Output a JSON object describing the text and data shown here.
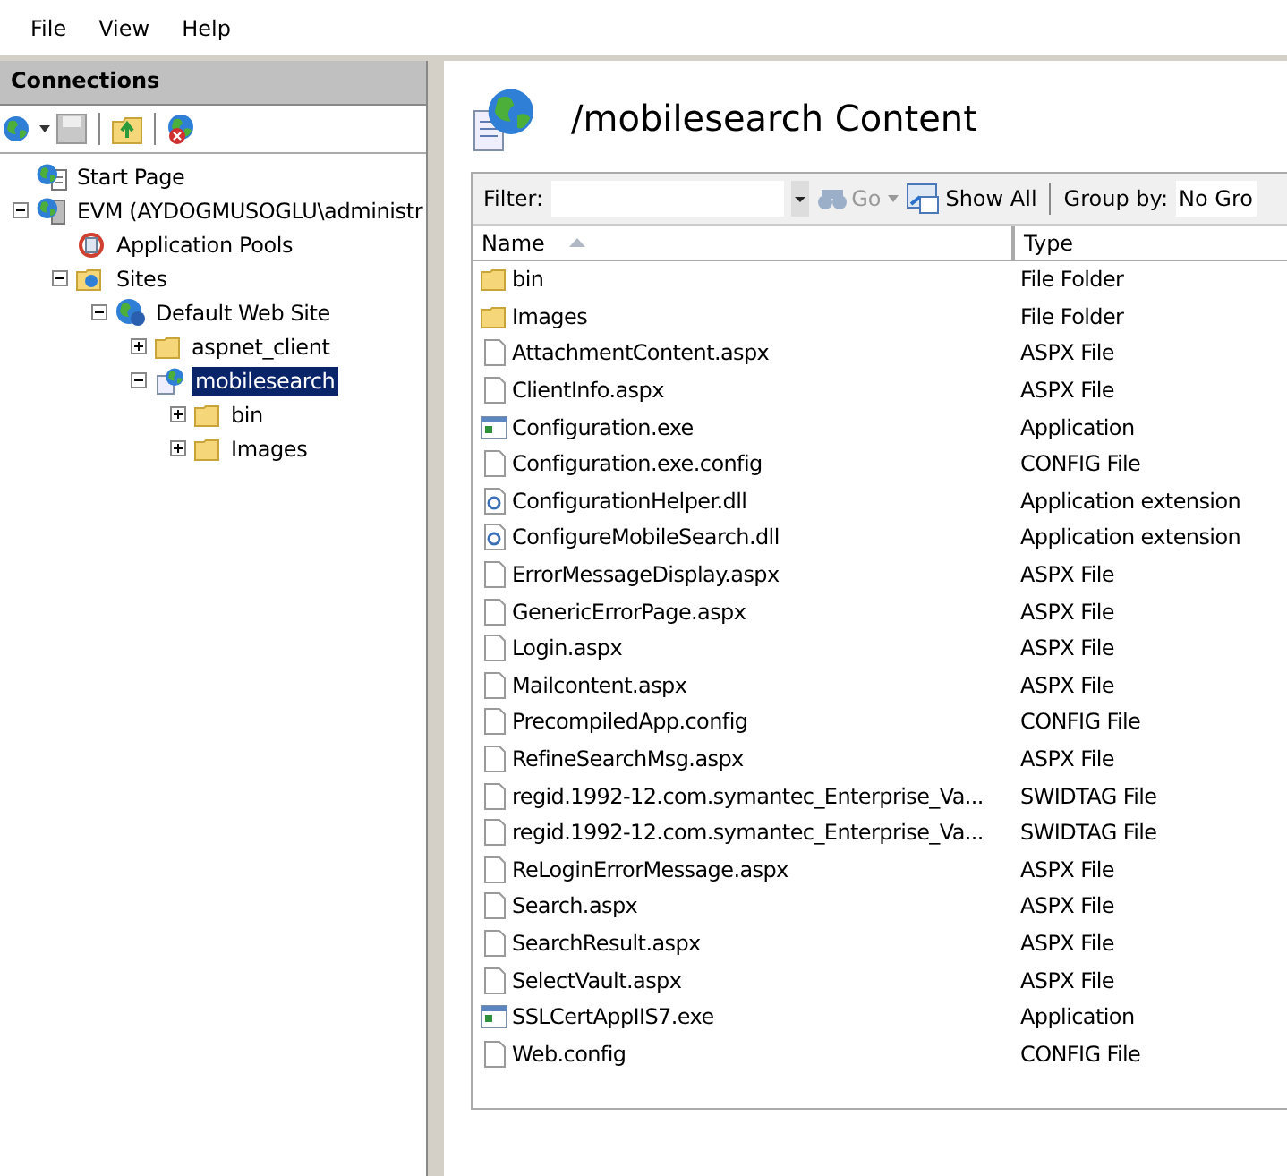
{
  "menu": [
    "File",
    "View",
    "Help"
  ],
  "connections": {
    "title": "Connections",
    "tree": [
      {
        "label": "Start Page",
        "kind": "start-page"
      },
      {
        "label": "EVM (AYDOGMUSOGLU\\administr",
        "kind": "server",
        "expanded": true,
        "children": [
          {
            "label": "Application Pools",
            "kind": "app-pools"
          },
          {
            "label": "Sites",
            "kind": "sites",
            "expanded": true,
            "children": [
              {
                "label": "Default Web Site",
                "kind": "website",
                "expanded": true,
                "children": [
                  {
                    "label": "aspnet_client",
                    "kind": "folder",
                    "expanded": false
                  },
                  {
                    "label": "mobilesearch",
                    "kind": "application",
                    "expanded": true,
                    "selected": true,
                    "children": [
                      {
                        "label": "bin",
                        "kind": "folder",
                        "expanded": false
                      },
                      {
                        "label": "Images",
                        "kind": "folder",
                        "expanded": false
                      }
                    ]
                  }
                ]
              }
            ]
          }
        ]
      }
    ]
  },
  "content": {
    "title": "/mobilesearch Content",
    "filter": {
      "label": "Filter:",
      "go": "Go",
      "show_all": "Show All",
      "group_by_label": "Group by:",
      "group_by_value": "No Gro"
    },
    "columns": [
      "Name",
      "Type"
    ],
    "rows": [
      {
        "name": "bin",
        "type": "File Folder",
        "kind": "folder"
      },
      {
        "name": "Images",
        "type": "File Folder",
        "kind": "folder"
      },
      {
        "name": "AttachmentContent.aspx",
        "type": "ASPX File",
        "kind": "file"
      },
      {
        "name": "ClientInfo.aspx",
        "type": "ASPX File",
        "kind": "file"
      },
      {
        "name": "Configuration.exe",
        "type": "Application",
        "kind": "exe"
      },
      {
        "name": "Configuration.exe.config",
        "type": "CONFIG File",
        "kind": "file"
      },
      {
        "name": "ConfigurationHelper.dll",
        "type": "Application extension",
        "kind": "dll"
      },
      {
        "name": "ConfigureMobileSearch.dll",
        "type": "Application extension",
        "kind": "dll"
      },
      {
        "name": "ErrorMessageDisplay.aspx",
        "type": "ASPX File",
        "kind": "file"
      },
      {
        "name": "GenericErrorPage.aspx",
        "type": "ASPX File",
        "kind": "file"
      },
      {
        "name": "Login.aspx",
        "type": "ASPX File",
        "kind": "file"
      },
      {
        "name": "Mailcontent.aspx",
        "type": "ASPX File",
        "kind": "file"
      },
      {
        "name": "PrecompiledApp.config",
        "type": "CONFIG File",
        "kind": "file"
      },
      {
        "name": "RefineSearchMsg.aspx",
        "type": "ASPX File",
        "kind": "file"
      },
      {
        "name": "regid.1992-12.com.symantec_Enterprise_Va...",
        "type": "SWIDTAG File",
        "kind": "file"
      },
      {
        "name": "regid.1992-12.com.symantec_Enterprise_Va...",
        "type": "SWIDTAG File",
        "kind": "file"
      },
      {
        "name": "ReLoginErrorMessage.aspx",
        "type": "ASPX File",
        "kind": "file"
      },
      {
        "name": "Search.aspx",
        "type": "ASPX File",
        "kind": "file"
      },
      {
        "name": "SearchResult.aspx",
        "type": "ASPX File",
        "kind": "file"
      },
      {
        "name": "SelectVault.aspx",
        "type": "ASPX File",
        "kind": "file"
      },
      {
        "name": "SSLCertAppIIS7.exe",
        "type": "Application",
        "kind": "exe"
      },
      {
        "name": "Web.config",
        "type": "CONFIG File",
        "kind": "file"
      }
    ]
  }
}
